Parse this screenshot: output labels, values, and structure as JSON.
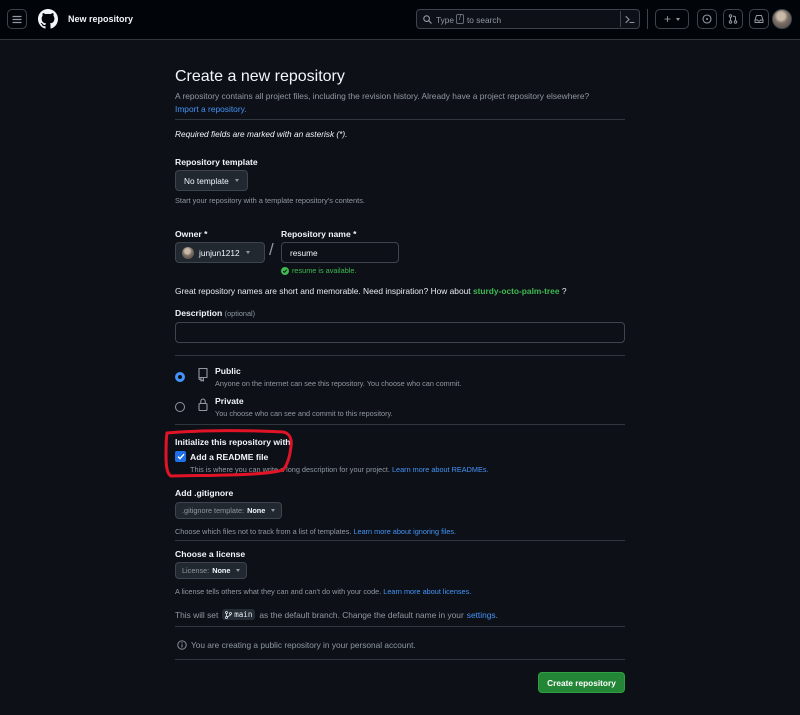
{
  "header": {
    "title": "New repository",
    "search_prefix": "Type",
    "search_key": "/",
    "search_suffix": "to search",
    "plus_label": "+"
  },
  "page": {
    "title": "Create a new repository",
    "intro": "A repository contains all project files, including the revision history. Already have a project repository elsewhere?",
    "import_link": "Import a repository.",
    "required_note": "Required fields are marked with an asterisk (*).",
    "template_label": "Repository template",
    "template_value": "No template",
    "template_help": "Start your repository with a template repository's contents.",
    "owner_label": "Owner *",
    "owner_value": "junjun1212",
    "slash": "/",
    "repo_label": "Repository name *",
    "repo_value": "resume",
    "available_text": "resume is available.",
    "inspiration_prefix": "Great repository names are short and memorable. Need inspiration? How about",
    "inspiration_name": "sturdy-octo-palm-tree",
    "inspiration_suffix": "?",
    "description_label": "Description",
    "description_optional": "(optional)",
    "description_value": "",
    "public_label": "Public",
    "public_help": "Anyone on the internet can see this repository. You choose who can commit.",
    "private_label": "Private",
    "private_help": "You choose who can see and commit to this repository.",
    "init_label": "Initialize this repository with:",
    "readme_label": "Add a README file",
    "readme_help": "This is where you can write a long description for your project.",
    "readme_link": "Learn more about READMEs.",
    "gitignore_label": "Add .gitignore",
    "gitignore_btn_prefix": ".gitignore template:",
    "gitignore_btn_value": "None",
    "gitignore_help": "Choose which files not to track from a list of templates.",
    "gitignore_link": "Learn more about ignoring files.",
    "license_label": "Choose a license",
    "license_btn_prefix": "License:",
    "license_btn_value": "None",
    "license_help": "A license tells others what they can and can't do with your code.",
    "license_link": "Learn more about licenses.",
    "branch_prefix": "This will set",
    "branch_name": "main",
    "branch_middle": "as the default branch. Change the default name in your",
    "branch_link": "settings",
    "branch_end": ".",
    "public_note": "You are creating a public repository in your personal account.",
    "create_button": "Create repository"
  },
  "colors": {
    "background": "#0d1117",
    "accent_blue": "#4493f8",
    "success_green": "#3fb950",
    "create_button": "#238636",
    "annotation_red": "#e01426"
  },
  "state": {
    "visibility": "public",
    "readme_checked": true
  }
}
